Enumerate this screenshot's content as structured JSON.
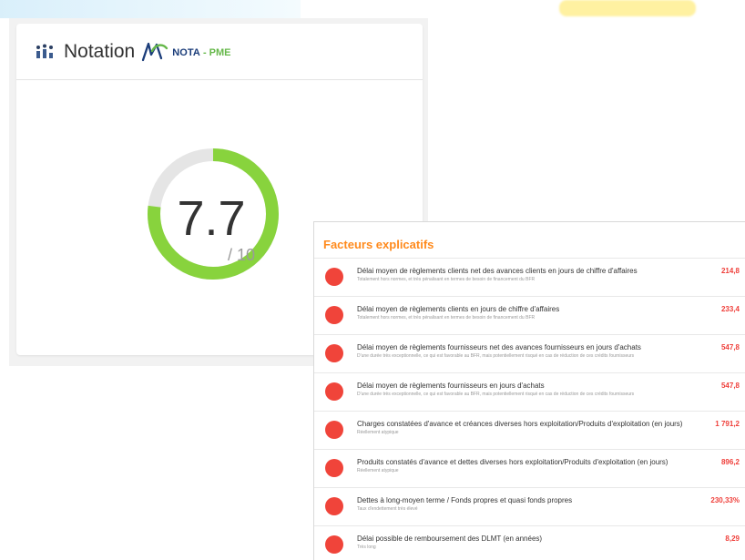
{
  "notation": {
    "title": "Notation",
    "logo": {
      "nota": "NOTA",
      "separator": "-",
      "pme": "PME"
    },
    "score": "7.7",
    "score_suffix": "/ 10",
    "score_value": 7.7,
    "score_max": 10,
    "colors": {
      "gauge_fill": "#88d33d",
      "gauge_track": "#e5e5e5"
    },
    "icons": {
      "header": "bar-chart-people-icon",
      "logo": "nota-pme-logo-icon"
    }
  },
  "factors": {
    "title": "Facteurs explicatifs",
    "items": [
      {
        "title": "Délai moyen de règlements clients net des avances clients en jours de chiffre d'affaires",
        "description": "Totalement hors normes, et très pénalisant en termes de besoin de financement du BFR",
        "value": "214,8"
      },
      {
        "title": "Délai moyen de règlements clients en jours de chiffre d'affaires",
        "description": "Totalement hors normes, et très pénalisant en termes de besoin de financement du BFR",
        "value": "233,4"
      },
      {
        "title": "Délai moyen de règlements fournisseurs net des avances fournisseurs en jours d'achats",
        "description": "D'une durée très exceptionnelle, ce qui est favorable au BFR, mais potentiellement risqué en cas de réduction de ces crédits fournisseurs",
        "value": "547,8"
      },
      {
        "title": "Délai moyen de règlements fournisseurs en jours d'achats",
        "description": "D'une durée très exceptionnelle, ce qui est favorable au BFR, mais potentiellement risqué en cas de réduction de ces crédits fournisseurs",
        "value": "547,8"
      },
      {
        "title": "Charges constatées d'avance et créances diverses hors exploitation/Produits d'exploitation (en jours)",
        "description": "Réellement atypique",
        "value": "1 791,2"
      },
      {
        "title": "Produits constatés d'avance et dettes diverses hors exploitation/Produits d'exploitation (en jours)",
        "description": "Réellement atypique",
        "value": "896,2"
      },
      {
        "title": "Dettes à long-moyen terme / Fonds propres et quasi fonds propres",
        "description": "Taux d'endettement très élevé",
        "value": "230,33%"
      },
      {
        "title": "Délai possible de remboursement des DLMT (en années)",
        "description": "Très long",
        "value": "8,29"
      }
    ],
    "colors": {
      "title": "#ff8a1c",
      "status_dot": "#f0443a",
      "value": "#ef3f3a"
    }
  }
}
